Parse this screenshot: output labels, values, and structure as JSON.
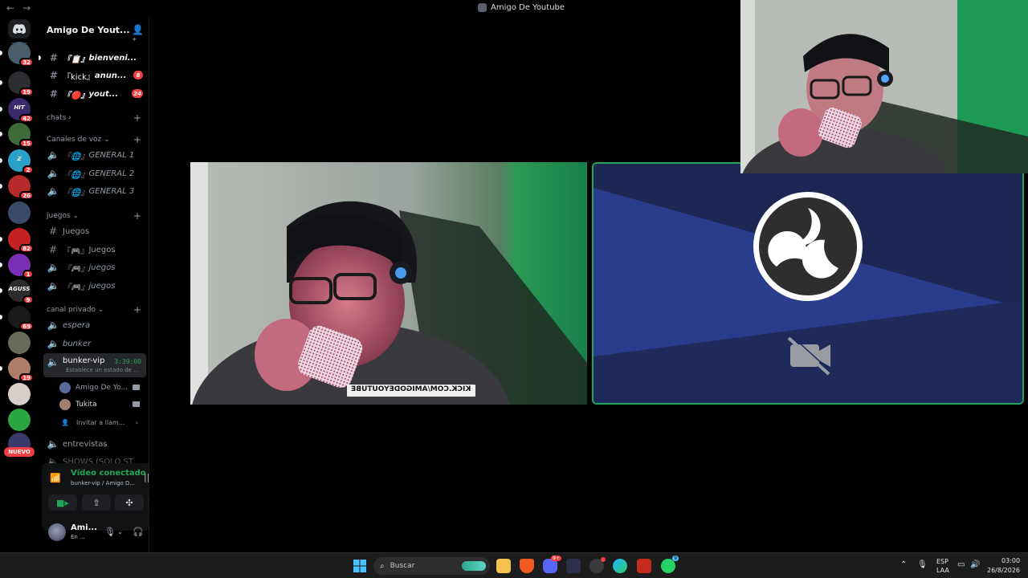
{
  "window": {
    "title": "Amigo De Youtube",
    "back_arrow": "←",
    "forward_arrow": "→"
  },
  "servers": [
    {
      "badge": "32",
      "color": "#4a5d6a"
    },
    {
      "badge": "19",
      "color": "#2b2d31"
    },
    {
      "badge": "42",
      "color": "#3b2a6b",
      "label": "HIT"
    },
    {
      "badge": "15",
      "color": "#3f6b3a"
    },
    {
      "badge": "2",
      "color": "#2ba1c9",
      "label": "Z"
    },
    {
      "badge": "26",
      "color": "#b52a2a"
    },
    {
      "badge": "",
      "color": "#3a4a6a"
    },
    {
      "badge": "82",
      "color": "#c42121"
    },
    {
      "badge": "1",
      "color": "#7a2fb5"
    },
    {
      "badge": "9",
      "color": "#2c2c2c",
      "label": "AGUSS"
    },
    {
      "badge": "69",
      "color": "#1a1a1a"
    },
    {
      "badge": "",
      "color": "#6a6a5a"
    },
    {
      "badge": "19",
      "color": "#b07a6a"
    },
    {
      "badge": "",
      "color": "#d8d0c8"
    },
    {
      "badge": "",
      "color": "#2ba640"
    },
    {
      "badge": "",
      "color": "#3a3a6a"
    }
  ],
  "nuevo_label": "NUEVO",
  "server": {
    "name": "Amigo De Yout...",
    "chevron": "⌄"
  },
  "channels_top": [
    {
      "prefix": "『📋』",
      "name": "bienveni...",
      "badge": ""
    },
    {
      "prefix": "『kick』",
      "name": "anun...",
      "badge": "8"
    },
    {
      "prefix": "『🔴』",
      "name": "yout...",
      "badge": "24"
    }
  ],
  "categories": {
    "chats": "chats ›",
    "voz": "Canales de voz ⌄",
    "juegos": "juegos ⌄",
    "privado": "canal privado ⌄"
  },
  "voice_general": [
    {
      "prefix": "『🌐』",
      "name": "GENERAL 1"
    },
    {
      "prefix": "『🌐』",
      "name": "GENERAL 2"
    },
    {
      "prefix": "『🌐』",
      "name": "GENERAL 3"
    }
  ],
  "juegos_channels": [
    {
      "glyph": "#",
      "prefix": "",
      "name": "Juegos"
    },
    {
      "glyph": "#",
      "prefix": "『🎮』",
      "name": "Juegos"
    },
    {
      "glyph": "🔈",
      "prefix": "『🎮』",
      "name": "juegos"
    },
    {
      "glyph": "🔈",
      "prefix": "『🎮』",
      "name": "juegos"
    }
  ],
  "privado_channels": [
    {
      "name": "espera"
    },
    {
      "name": "bunker"
    }
  ],
  "active_channel": {
    "name": "bunker-vip",
    "timer": "3:39:00",
    "status": "Establece un estado de ..."
  },
  "voice_users": [
    {
      "name": "Amigo De Yo...",
      "color": "#5a6c9c"
    },
    {
      "name": "Tukita",
      "color": "#a08070"
    }
  ],
  "invite_label": "Invitar a llam...",
  "more_channels": [
    {
      "name": "entrevistas"
    },
    {
      "name": "SHOWS (SOLO ST..."
    }
  ],
  "voice_panel": {
    "title": "Vídeo conectado",
    "subtitle": "bunker-vip / Amigo D..."
  },
  "user": {
    "name": "Ami...",
    "status": "En ..."
  },
  "stream": {
    "overlay_text": "KICK.COM/AMIGODEYOUTUBE"
  },
  "taskbar": {
    "search_placeholder": "Buscar",
    "lang": "ESP",
    "lang_sub": "LAA",
    "time": "03:00",
    "date": "26/8/2026",
    "discord_badge": "9+",
    "whatsapp_badge": "9"
  },
  "colors": {
    "accent_green": "#23a55a",
    "badge_red": "#f23f43",
    "obs_blue": "#1a2352"
  }
}
